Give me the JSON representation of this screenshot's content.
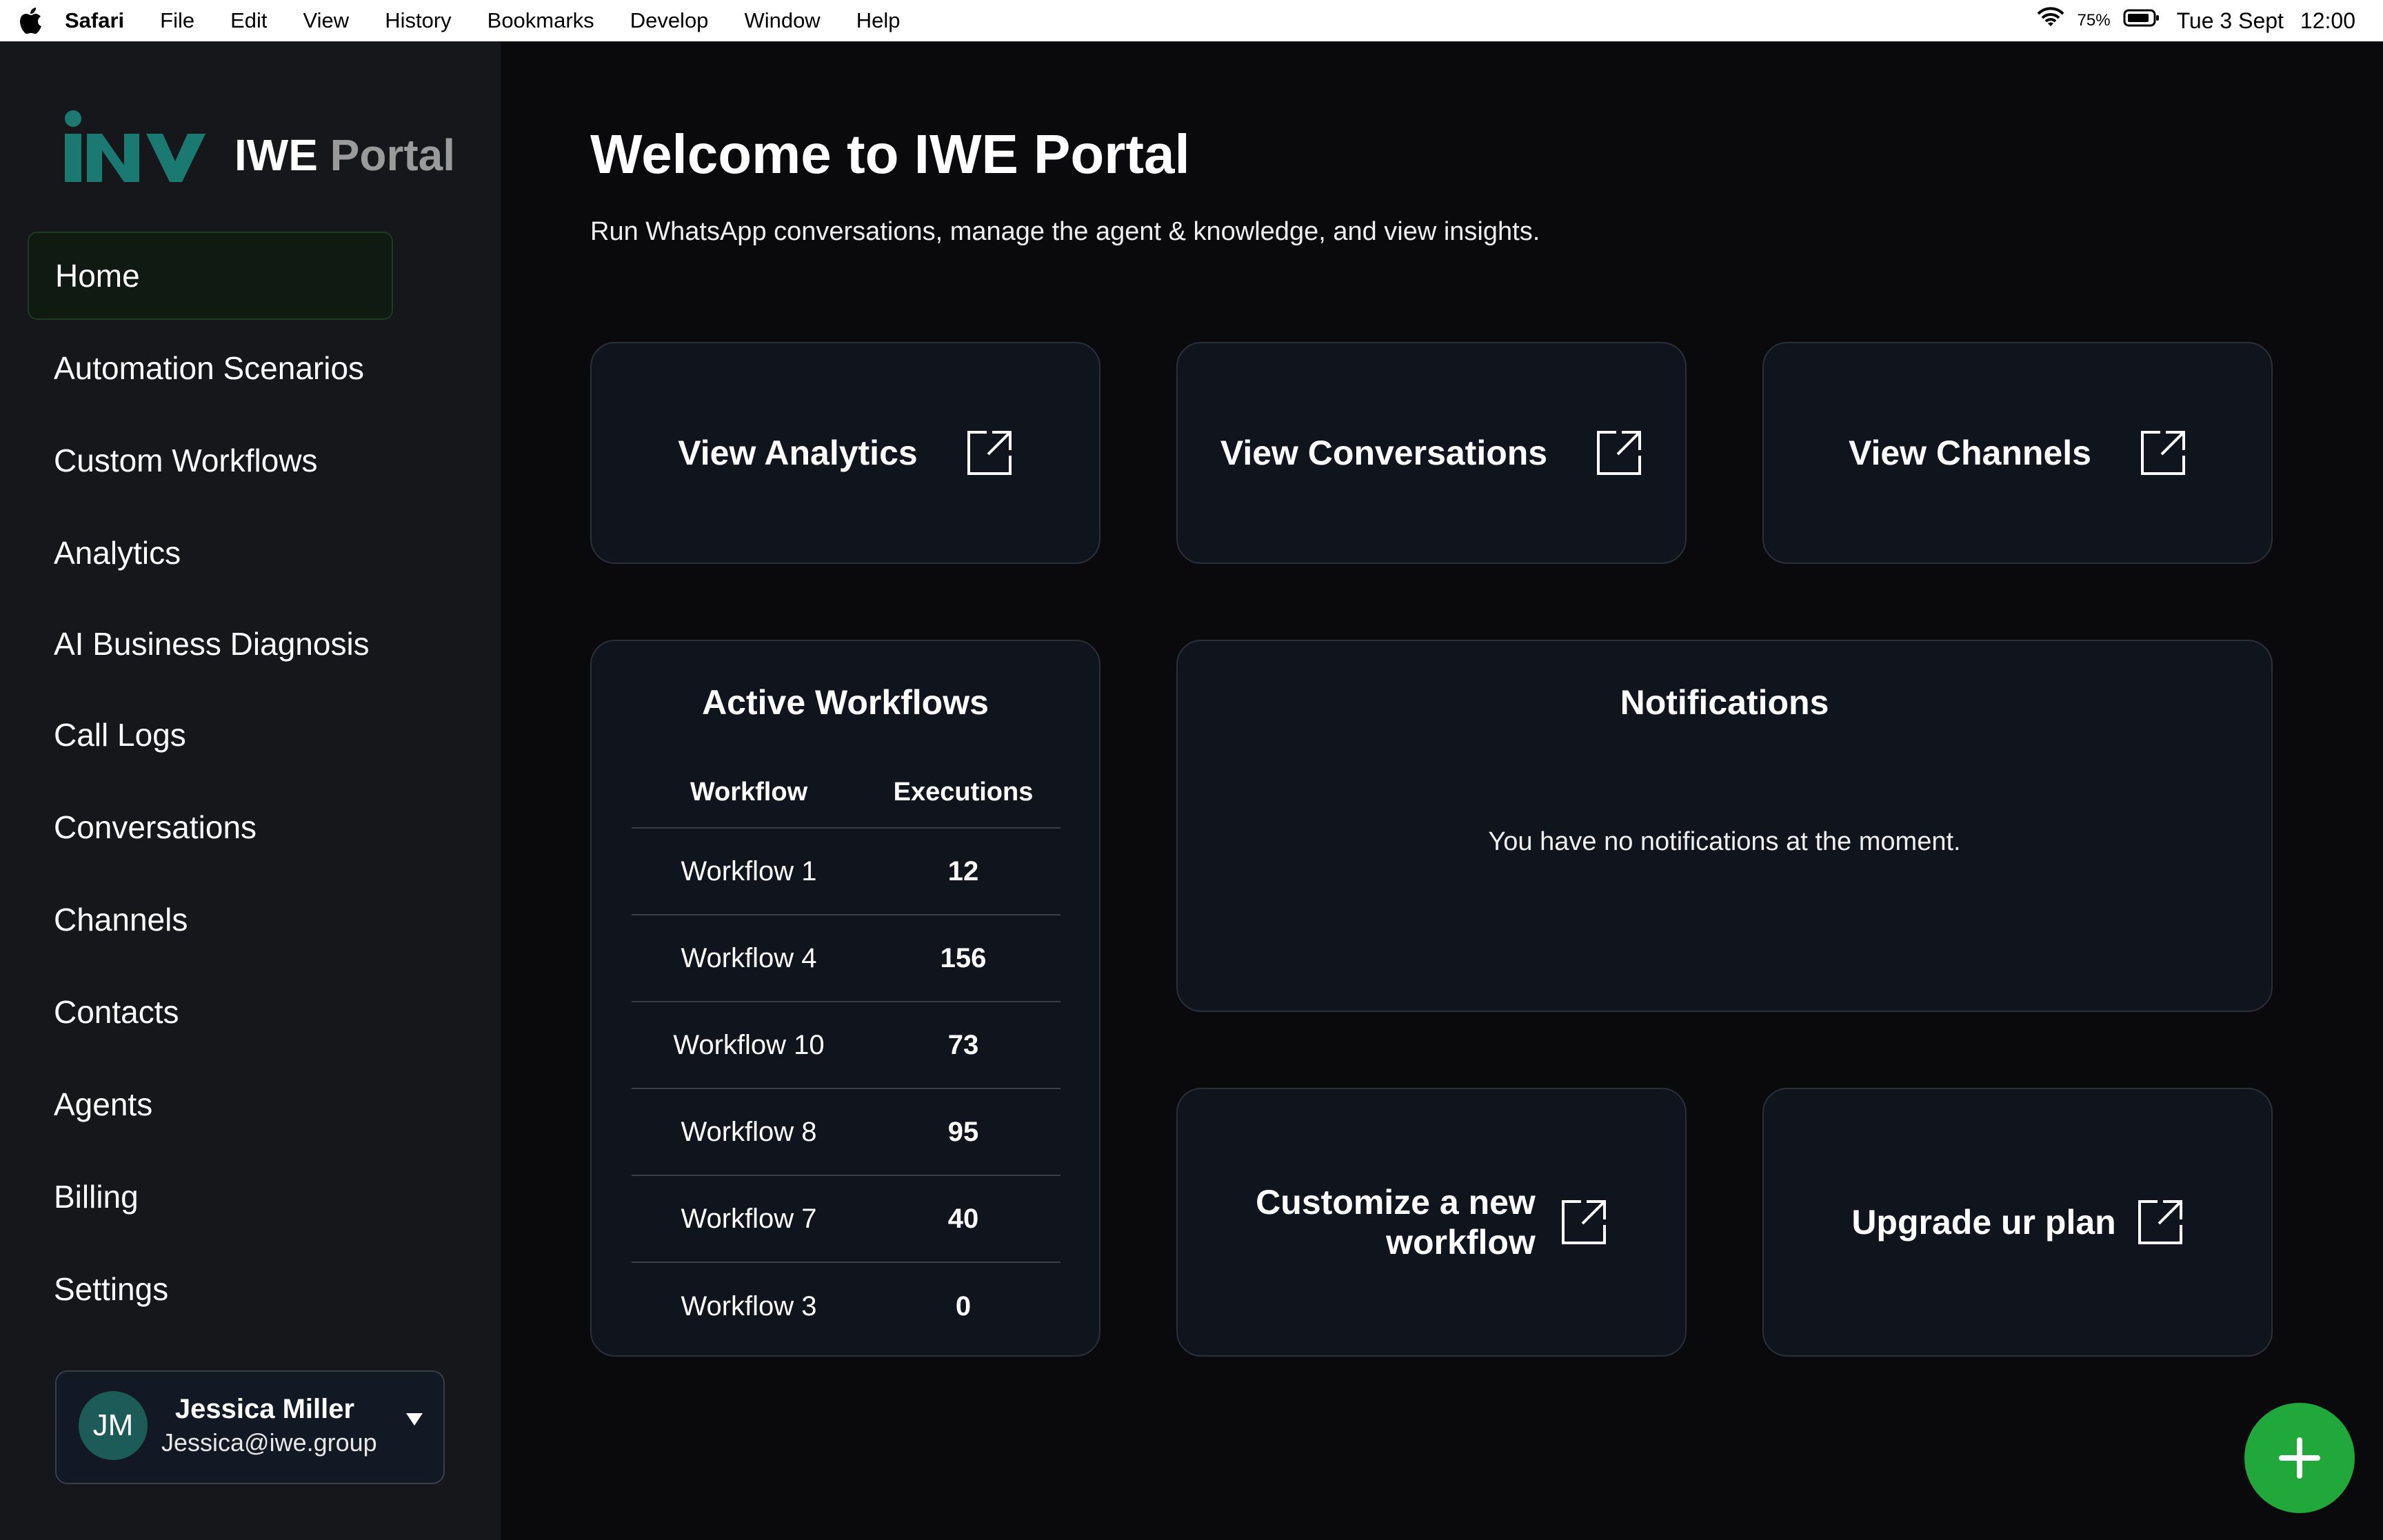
{
  "menubar": {
    "app_name": "Safari",
    "items": [
      "File",
      "Edit",
      "View",
      "History",
      "Bookmarks",
      "Develop",
      "Window",
      "Help"
    ],
    "battery_percent": "75%",
    "date": "Tue 3 Sept",
    "time": "12:00"
  },
  "brand": {
    "name_main": "IWE",
    "name_accent": "Portal",
    "logo_color": "#1a7a72",
    "accent_green": "#21a83a"
  },
  "sidebar": {
    "items": [
      {
        "label": "Home",
        "active": true
      },
      {
        "label": "Automation Scenarios"
      },
      {
        "label": "Custom Workflows"
      },
      {
        "label": "Analytics"
      },
      {
        "label": "AI Business Diagnosis"
      },
      {
        "label": "Call Logs"
      },
      {
        "label": "Conversations"
      },
      {
        "label": "Channels"
      },
      {
        "label": "Contacts"
      },
      {
        "label": "Agents"
      },
      {
        "label": "Billing"
      },
      {
        "label": "Settings"
      }
    ]
  },
  "user": {
    "initials": "JM",
    "name": "Jessica Miller",
    "email": "Jessica@iwe.group"
  },
  "main": {
    "title": "Welcome to IWE Portal",
    "subtitle": "Run WhatsApp conversations, manage the agent & knowledge, and view insights.",
    "quick_links": {
      "analytics": "View Analytics",
      "conversations": "View Conversations",
      "channels": "View Channels",
      "customize_line1": "Customize a new",
      "customize_line2": "workflow",
      "upgrade": "Upgrade ur plan"
    },
    "active_workflows": {
      "title": "Active Workflows",
      "col_workflow": "Workflow",
      "col_executions": "Executions",
      "rows": [
        {
          "name": "Workflow 1",
          "executions": "12"
        },
        {
          "name": "Workflow 4",
          "executions": "156"
        },
        {
          "name": "Workflow 10",
          "executions": "73"
        },
        {
          "name": "Workflow 8",
          "executions": "95"
        },
        {
          "name": "Workflow 7",
          "executions": "40"
        },
        {
          "name": "Workflow 3",
          "executions": "0"
        }
      ]
    },
    "notifications": {
      "title": "Notifications",
      "empty_message": "You have no notifications at the moment."
    },
    "fab_icon": "plus-icon"
  }
}
